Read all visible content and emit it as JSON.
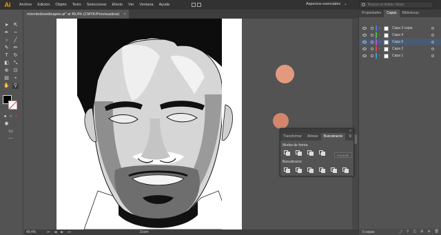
{
  "app": {
    "logo": "Ai"
  },
  "menu": [
    "Archivo",
    "Edición",
    "Objeto",
    "Texto",
    "Seleccionar",
    "Efecto",
    "Ver",
    "Ventana",
    "Ayuda"
  ],
  "workspace": {
    "label": "Aspectos esenciales"
  },
  "search": {
    "placeholder": "Buscar en Adobe Stock"
  },
  "document": {
    "tab_title": "mirentodosedicaprio.ai* al 49,4% (CMYK/Previsualizar)",
    "close": "×"
  },
  "status": {
    "zoom": "49,4%",
    "mode": "Zoom"
  },
  "floating_panel": {
    "tabs": [
      "Transformar",
      "Alinear",
      "Buscatrazos"
    ],
    "active_tab": "Buscatrazos",
    "shape_modes_label": "Modos de forma:",
    "expand_label": "Expandir",
    "pathfinders_label": "Buscatrazos:",
    "close": "×"
  },
  "right_panel": {
    "tabs": [
      "Propiedades",
      "Capas",
      "Bibliotecas"
    ],
    "active_tab": "Capas",
    "layers": [
      {
        "name": "Capa 2 copia",
        "color": "#4a7bd8"
      },
      {
        "name": "Capa 4",
        "color": "#4ac94a"
      },
      {
        "name": "Capa 5",
        "color": "#c94ad8"
      },
      {
        "name": "Capa 2",
        "color": "#d84a4a"
      },
      {
        "name": "Capa 1",
        "color": "#4a9ad8"
      }
    ],
    "layer_count": "5 capas"
  },
  "colors": {
    "salmon_circle": "#e29a7f",
    "salmon_circle_2": "#d4866c",
    "selection_accent": "#4a5a72"
  }
}
